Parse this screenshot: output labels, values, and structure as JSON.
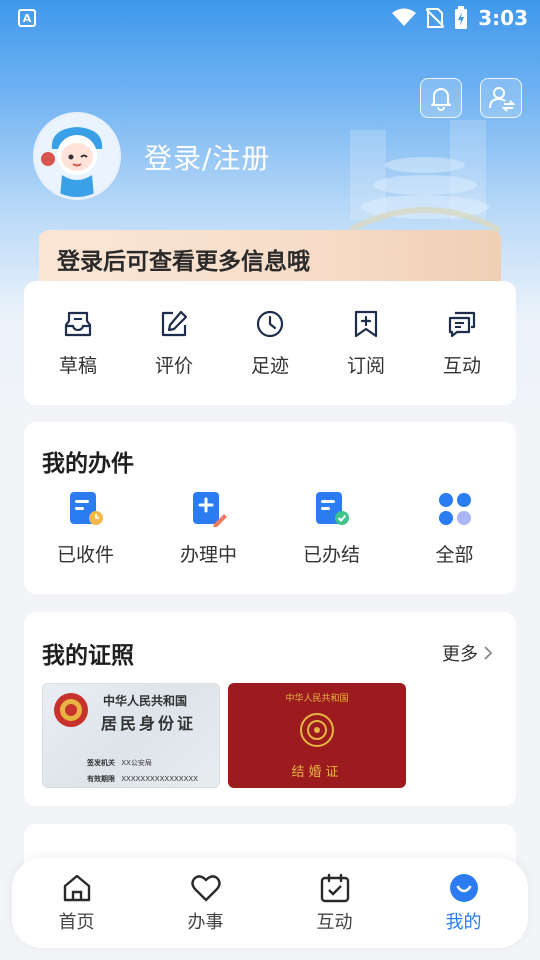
{
  "status_bar": {
    "time": "3:03",
    "app_icon_letter": "A"
  },
  "header": {
    "login_text": "登录/注册",
    "notification_icon": "bell-icon",
    "user_switch_icon": "user-switch-icon"
  },
  "banner": {
    "text": "登录后可查看更多信息哦"
  },
  "quick_actions": [
    {
      "label": "草稿",
      "icon": "draft-icon"
    },
    {
      "label": "评价",
      "icon": "edit-icon"
    },
    {
      "label": "足迹",
      "icon": "clock-icon"
    },
    {
      "label": "订阅",
      "icon": "bookmark-icon"
    },
    {
      "label": "互动",
      "icon": "chat-icon"
    }
  ],
  "my_work": {
    "title": "我的办件",
    "items": [
      {
        "label": "已收件",
        "icon": "received-doc-icon"
      },
      {
        "label": "办理中",
        "icon": "processing-doc-icon"
      },
      {
        "label": "已办结",
        "icon": "completed-doc-icon"
      },
      {
        "label": "全部",
        "icon": "all-grid-icon"
      }
    ]
  },
  "my_certs": {
    "title": "我的证照",
    "more_label": "更多",
    "id_card": {
      "country": "中华人民共和国",
      "name": "居民身份证",
      "authority_label": "签发机关",
      "authority_value": "XX公安局",
      "validity_label": "有效期限",
      "validity_value": "XXXXXXXXXXXXXXXX"
    },
    "marriage_cert": {
      "country": "中华人民共和国",
      "name": "结婚证"
    }
  },
  "tabbar": {
    "items": [
      {
        "label": "首页",
        "icon": "home-icon",
        "active": false
      },
      {
        "label": "办事",
        "icon": "heart-icon",
        "active": false
      },
      {
        "label": "互动",
        "icon": "calendar-check-icon",
        "active": false
      },
      {
        "label": "我的",
        "icon": "smile-icon",
        "active": true
      }
    ]
  },
  "colors": {
    "accent": "#2b7cf0",
    "header_blue": "#3f98ec",
    "marriage_red": "#9b1b1e"
  }
}
